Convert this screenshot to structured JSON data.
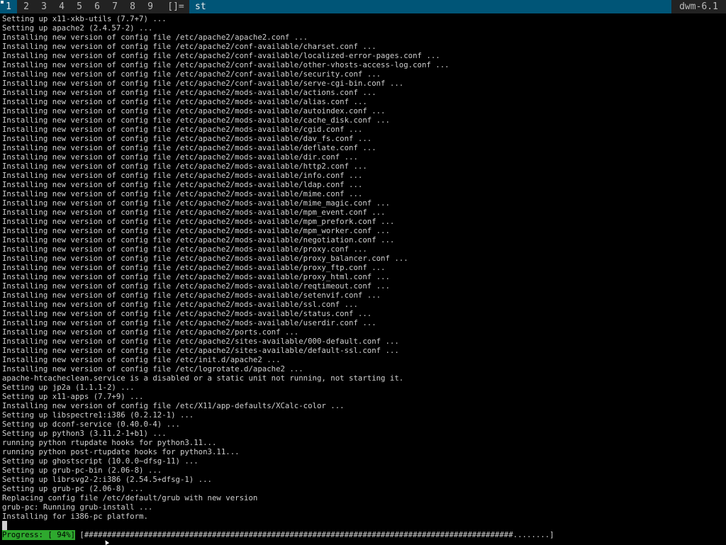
{
  "bar": {
    "tags": [
      "1",
      "2",
      "3",
      "4",
      "5",
      "6",
      "7",
      "8",
      "9"
    ],
    "selected_tag": "1",
    "layout_symbol": "[]=",
    "window_title": "st",
    "status": "dwm-6.1"
  },
  "terminal": {
    "lines": [
      "Setting up x11-xkb-utils (7.7+7) ...",
      "Setting up apache2 (2.4.57-2) ...",
      "Installing new version of config file /etc/apache2/apache2.conf ...",
      "Installing new version of config file /etc/apache2/conf-available/charset.conf ...",
      "Installing new version of config file /etc/apache2/conf-available/localized-error-pages.conf ...",
      "Installing new version of config file /etc/apache2/conf-available/other-vhosts-access-log.conf ...",
      "Installing new version of config file /etc/apache2/conf-available/security.conf ...",
      "Installing new version of config file /etc/apache2/conf-available/serve-cgi-bin.conf ...",
      "Installing new version of config file /etc/apache2/mods-available/actions.conf ...",
      "Installing new version of config file /etc/apache2/mods-available/alias.conf ...",
      "Installing new version of config file /etc/apache2/mods-available/autoindex.conf ...",
      "Installing new version of config file /etc/apache2/mods-available/cache_disk.conf ...",
      "Installing new version of config file /etc/apache2/mods-available/cgid.conf ...",
      "Installing new version of config file /etc/apache2/mods-available/dav_fs.conf ...",
      "Installing new version of config file /etc/apache2/mods-available/deflate.conf ...",
      "Installing new version of config file /etc/apache2/mods-available/dir.conf ...",
      "Installing new version of config file /etc/apache2/mods-available/http2.conf ...",
      "Installing new version of config file /etc/apache2/mods-available/info.conf ...",
      "Installing new version of config file /etc/apache2/mods-available/ldap.conf ...",
      "Installing new version of config file /etc/apache2/mods-available/mime.conf ...",
      "Installing new version of config file /etc/apache2/mods-available/mime_magic.conf ...",
      "Installing new version of config file /etc/apache2/mods-available/mpm_event.conf ...",
      "Installing new version of config file /etc/apache2/mods-available/mpm_prefork.conf ...",
      "Installing new version of config file /etc/apache2/mods-available/mpm_worker.conf ...",
      "Installing new version of config file /etc/apache2/mods-available/negotiation.conf ...",
      "Installing new version of config file /etc/apache2/mods-available/proxy.conf ...",
      "Installing new version of config file /etc/apache2/mods-available/proxy_balancer.conf ...",
      "Installing new version of config file /etc/apache2/mods-available/proxy_ftp.conf ...",
      "Installing new version of config file /etc/apache2/mods-available/proxy_html.conf ...",
      "Installing new version of config file /etc/apache2/mods-available/reqtimeout.conf ...",
      "Installing new version of config file /etc/apache2/mods-available/setenvif.conf ...",
      "Installing new version of config file /etc/apache2/mods-available/ssl.conf ...",
      "Installing new version of config file /etc/apache2/mods-available/status.conf ...",
      "Installing new version of config file /etc/apache2/mods-available/userdir.conf ...",
      "Installing new version of config file /etc/apache2/ports.conf ...",
      "Installing new version of config file /etc/apache2/sites-available/000-default.conf ...",
      "Installing new version of config file /etc/apache2/sites-available/default-ssl.conf ...",
      "Installing new version of config file /etc/init.d/apache2 ...",
      "Installing new version of config file /etc/logrotate.d/apache2 ...",
      "apache-htcacheclean.service is a disabled or a static unit not running, not starting it.",
      "Setting up jp2a (1.1.1-2) ...",
      "Setting up x11-apps (7.7+9) ...",
      "Installing new version of config file /etc/X11/app-defaults/XCalc-color ...",
      "Setting up libspectre1:i386 (0.2.12-1) ...",
      "Setting up dconf-service (0.40.0-4) ...",
      "Setting up python3 (3.11.2-1+b1) ...",
      "running python rtupdate hooks for python3.11...",
      "running python post-rtupdate hooks for python3.11...",
      "Setting up ghostscript (10.0.0~dfsg-11) ...",
      "Setting up grub-pc-bin (2.06-8) ...",
      "Setting up librsvg2-2:i386 (2.54.5+dfsg-1) ...",
      "Setting up grub-pc (2.06-8) ...",
      "Replacing config file /etc/default/grub with new version",
      "grub-pc: Running grub-install ...",
      "Installing for i386-pc platform."
    ],
    "progress_label": "Progress: [ 94%]",
    "progress_bar": "[##############################################################################################........]",
    "progress_fraction": 0.94
  },
  "colors": {
    "bar_bg": "#222222",
    "bar_selected_bg": "#005577",
    "terminal_bg": "#000000",
    "terminal_fg": "#d0d0d0",
    "progress_bg": "#2ea82e"
  }
}
